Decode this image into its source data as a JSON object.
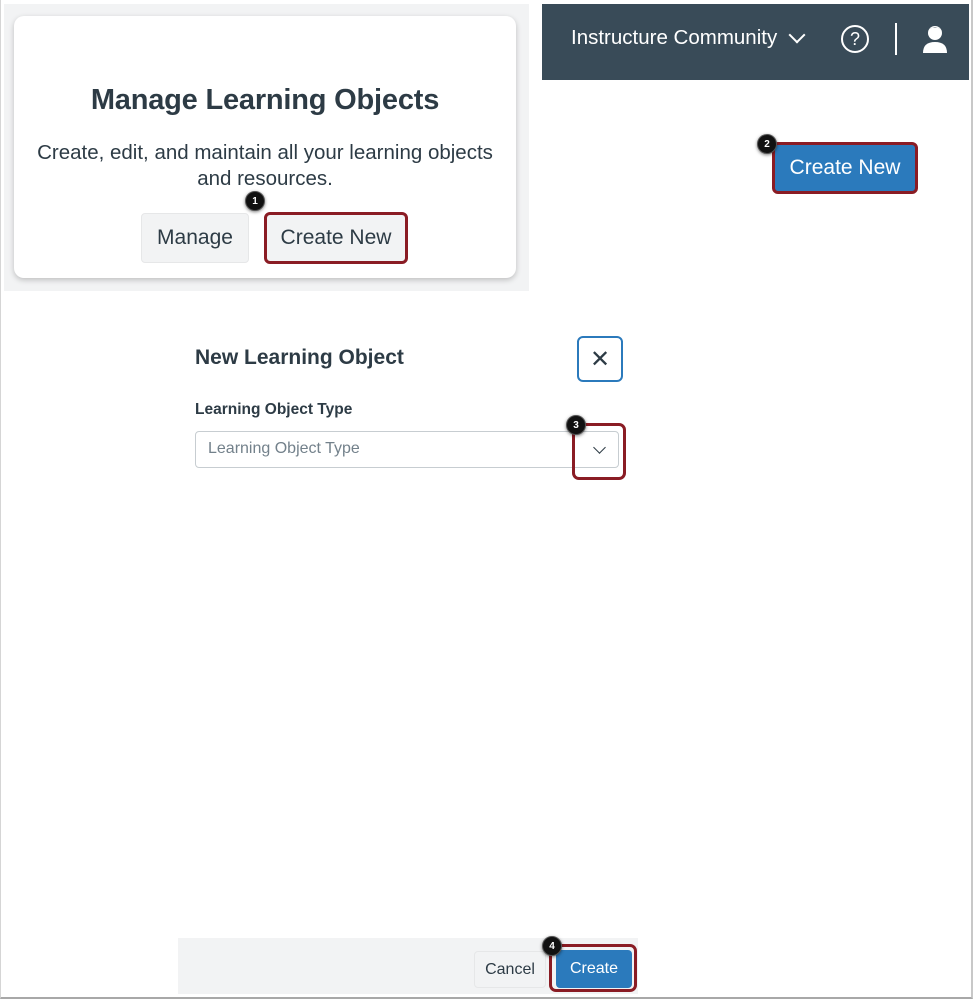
{
  "card": {
    "title": "Manage Learning Objects",
    "description": "Create, edit, and maintain all your learning objects and resources.",
    "manage_label": "Manage",
    "create_new_label": "Create New"
  },
  "header": {
    "title": "Instructure Community",
    "help_glyph": "?",
    "icons": [
      "chevron-down-icon",
      "help-icon",
      "user-icon"
    ]
  },
  "toolbar": {
    "create_new_label": "Create New"
  },
  "modal": {
    "title": "New Learning Object",
    "close_glyph": "✕",
    "field_label": "Learning Object Type",
    "select_placeholder": "Learning Object Type",
    "cancel_label": "Cancel",
    "create_label": "Create"
  },
  "steps": [
    "1",
    "2",
    "3",
    "4"
  ],
  "colors": {
    "header_bg": "#394b58",
    "primary": "#2b7abc",
    "highlight": "#8a1c24",
    "text": "#2d3b45"
  }
}
